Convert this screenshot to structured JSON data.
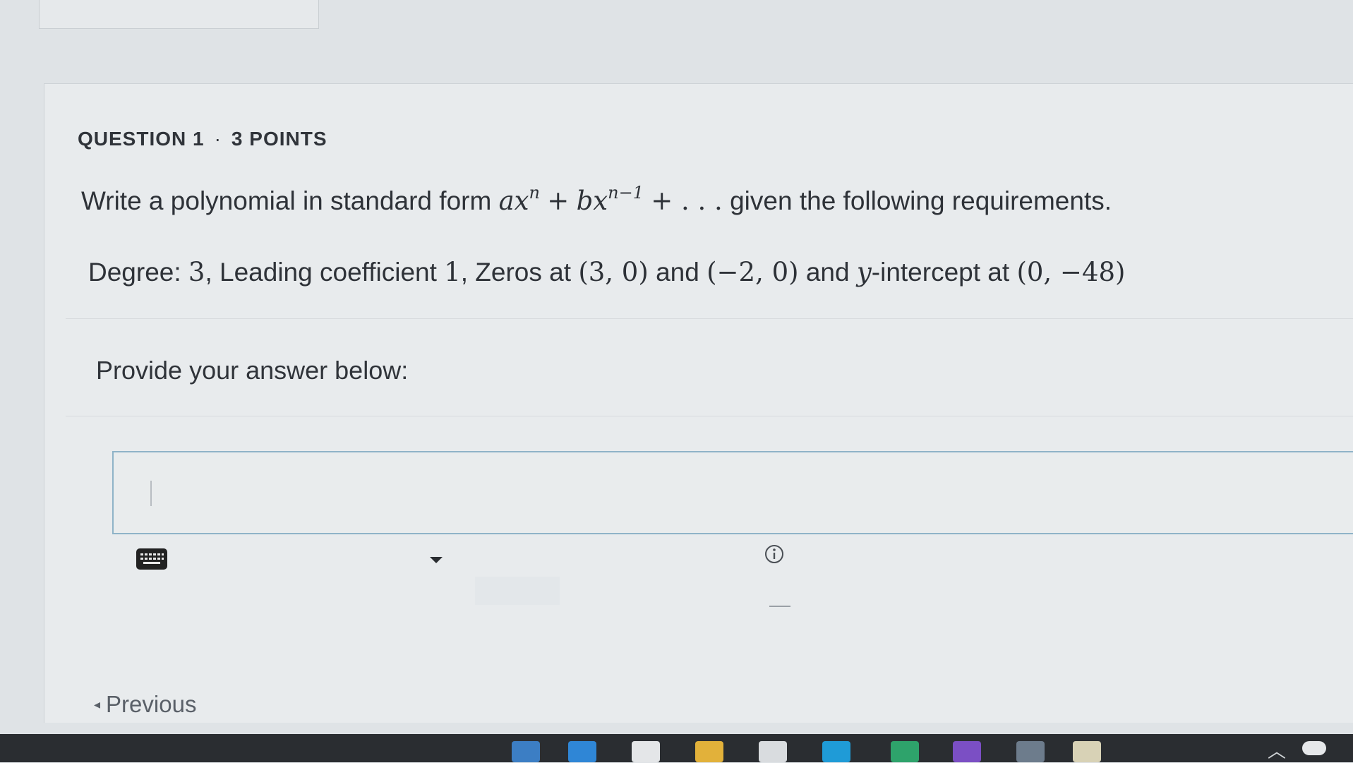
{
  "question": {
    "number_label": "QUESTION 1",
    "separator": "·",
    "points_label": "3 POINTS",
    "text_before": "Write a polynomial in standard form",
    "formula_a": "a",
    "formula_x": "x",
    "formula_exp1": "n",
    "formula_plus1": "+",
    "formula_b": "b",
    "formula_x2": "x",
    "formula_exp2": "n−1",
    "formula_tail": "+ . . .",
    "text_after": "given the following requirements.",
    "req_degree_label": "Degree:",
    "req_degree_value": "3",
    "req_leading_label": ", Leading coefficient",
    "req_leading_value": "1",
    "req_zeros_label": ", Zeros at",
    "req_zero1": "(3, 0)",
    "req_and1": "and",
    "req_zero2": "(−2, 0)",
    "req_and2": "and",
    "req_y": "y",
    "req_intercept_label": "-intercept at",
    "req_intercept_value": "(0, −48)"
  },
  "answer": {
    "prompt": "Provide your answer below:",
    "value": ""
  },
  "navigation": {
    "previous_label": "Previous"
  },
  "icons": {
    "keyboard": "keyboard-icon",
    "dropdown": "caret-down-icon",
    "info": "info-icon",
    "previous": "chevron-left-icon"
  },
  "colors": {
    "answer_border": "#8fb3c8",
    "taskbar": "#2a2d31"
  }
}
